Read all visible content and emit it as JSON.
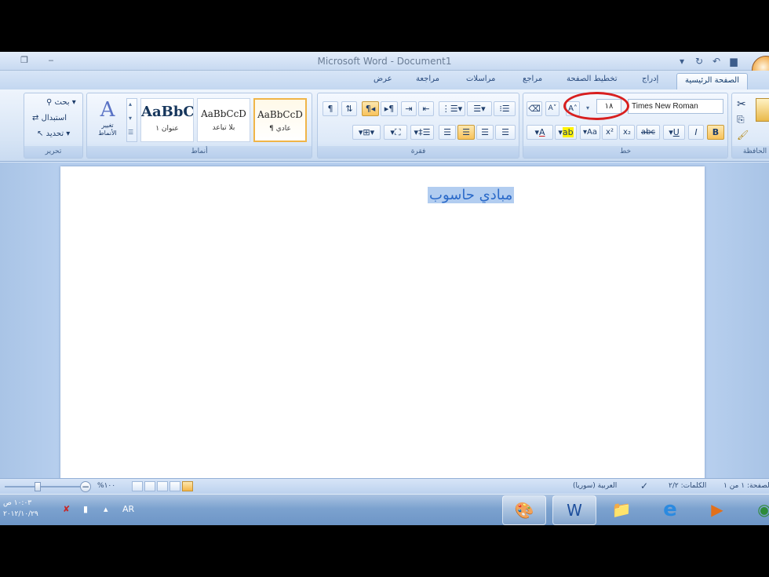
{
  "window": {
    "title": "Microsoft Word - Document1"
  },
  "tabs": [
    "الصفحة الرئيسية",
    "إدراج",
    "تخطيط الصفحة",
    "مراجع",
    "مراسلات",
    "مراجعة",
    "عرض"
  ],
  "ribbon": {
    "editing": {
      "label": "تحرير",
      "find": "بحث",
      "replace": "استبدال",
      "select": "تحديد"
    },
    "styles": {
      "label": "أنماط",
      "change_styles": "تغيير الأنماط",
      "items": [
        {
          "sample": "AaBbC(",
          "name": "عنوان ١"
        },
        {
          "sample": "AaBbCcD",
          "name": "بلا تباعد"
        },
        {
          "sample": "AaBbCcD",
          "name": "¶ عادي"
        }
      ]
    },
    "paragraph": {
      "label": "فقرة"
    },
    "font": {
      "label": "خط",
      "name": "Times New Roman",
      "size": "١٨"
    },
    "clipboard": {
      "label": "الحافظة"
    }
  },
  "document": {
    "text": "مبادي حاسوب"
  },
  "statusbar": {
    "page": "الصفحة: ١ من ١",
    "words": "الكلمات: ٢/٢",
    "language": "العربية (سوريا)",
    "zoom": "%١٠٠"
  },
  "taskbar": {
    "lang": "AR",
    "time": "١٠:٠٣ ص",
    "date": "٢٠١٢/١٠/٢٩"
  }
}
